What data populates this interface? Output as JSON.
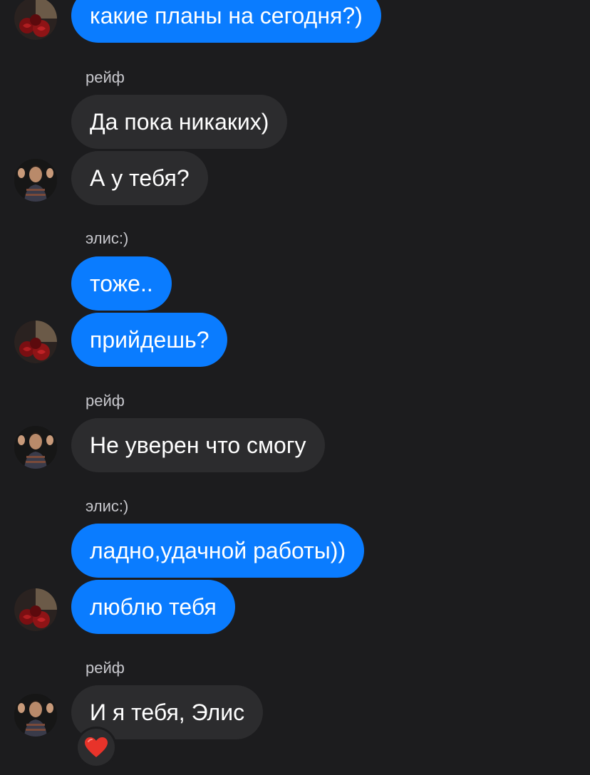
{
  "conversation": {
    "messages": [
      {
        "text": "какие планы на сегодня?)",
        "author": "элис:)",
        "direction": "outgoing"
      },
      {
        "text": "Да пока никаких)",
        "author": "рейф",
        "direction": "incoming"
      },
      {
        "text": "А у тебя?",
        "author": "рейф",
        "direction": "incoming"
      },
      {
        "text": "тоже..",
        "author": "элис:)",
        "direction": "outgoing"
      },
      {
        "text": "прийдешь?",
        "author": "элис:)",
        "direction": "outgoing"
      },
      {
        "text": "Не уверен что смогу",
        "author": "рейф",
        "direction": "incoming"
      },
      {
        "text": "ладно,удачной работы))",
        "author": "элис:)",
        "direction": "outgoing"
      },
      {
        "text": "люблю тебя",
        "author": "элис:)",
        "direction": "outgoing"
      },
      {
        "text": "И я тебя, Элис",
        "author": "рейф",
        "direction": "incoming"
      }
    ],
    "sender_labels": [
      {
        "name": "рейф"
      },
      {
        "name": "элис:)"
      },
      {
        "name": "рейф"
      },
      {
        "name": "элис:)"
      },
      {
        "name": "рейф"
      }
    ],
    "reaction": {
      "emoji": "heart-icon",
      "color": "#e8332a"
    }
  },
  "colors": {
    "background": "#1c1c1e",
    "outgoing_bubble": "#0a7cff",
    "incoming_bubble": "#2c2c2e",
    "sender_label": "#c7c7cc"
  },
  "avatars": {
    "alice": "roses-avatar",
    "reif": "person-avatar"
  }
}
